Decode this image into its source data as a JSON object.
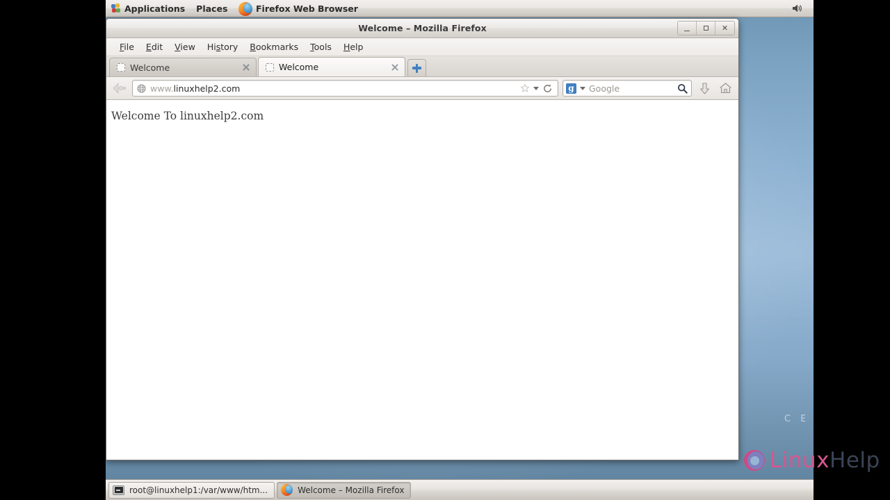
{
  "desktop": {
    "wallpaper_hint": "centos-blue-gradient",
    "watermark_centos": "C E",
    "watermark_logo": {
      "linux": "Linux",
      "help": "Help"
    },
    "accent_pink": "#d8568f",
    "accent_blue": "#3f7fc1"
  },
  "top_panel": {
    "applications_label": "Applications",
    "places_label": "Places",
    "active_app_label": "Firefox Web Browser",
    "volume_icon": "volume-icon"
  },
  "window": {
    "title": "Welcome – Mozilla Firefox",
    "controls": {
      "minimize": "_",
      "maximize": "□",
      "close": "×"
    }
  },
  "menubar": {
    "items": [
      {
        "label": "File",
        "accel": "F"
      },
      {
        "label": "Edit",
        "accel": "E"
      },
      {
        "label": "View",
        "accel": "V"
      },
      {
        "label": "History",
        "accel": "s"
      },
      {
        "label": "Bookmarks",
        "accel": "B"
      },
      {
        "label": "Tools",
        "accel": "T"
      },
      {
        "label": "Help",
        "accel": "H"
      }
    ]
  },
  "tabs": {
    "items": [
      {
        "title": "Welcome",
        "active": false
      },
      {
        "title": "Welcome",
        "active": true
      }
    ],
    "new_tab_tooltip": "Open a new tab"
  },
  "navbar": {
    "back_forward_icon": "back-forward-icon",
    "url": {
      "scheme_prefix": "www.",
      "rest": "linuxhelp2.com",
      "full": "www.linuxhelp2.com"
    },
    "identity_icon": "globe-icon",
    "bookmark_icon": "star-icon",
    "dropdown_icon": "chevron-down-icon",
    "reload_icon": "reload-icon",
    "search": {
      "engine": "Google",
      "placeholder": "Google",
      "engine_logo": "google-g-logo",
      "submit_icon": "search-icon"
    },
    "downloads_icon": "downloads-arrow-icon",
    "home_icon": "home-icon"
  },
  "content": {
    "heading": "Welcome To linuxhelp2.com"
  },
  "taskbar": {
    "items": [
      {
        "label": "root@linuxhelp1:/var/www/htm...",
        "icon": "terminal-icon",
        "active": false
      },
      {
        "label": "Welcome – Mozilla Firefox",
        "icon": "firefox-icon",
        "active": true
      }
    ]
  }
}
